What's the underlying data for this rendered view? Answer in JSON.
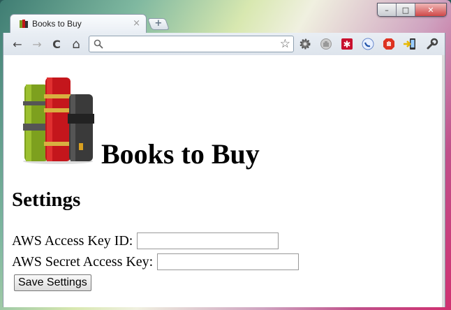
{
  "window": {
    "controls": {
      "minimize": "–",
      "maximize": "□",
      "close": "✕"
    }
  },
  "tab": {
    "title": "Books to Buy",
    "close": "×",
    "newtab": "+"
  },
  "toolbar": {
    "back": "←",
    "forward": "→",
    "reload": "C",
    "home": "⌂",
    "address_value": "",
    "star": "☆"
  },
  "page": {
    "site_title": "Books to Buy",
    "settings_heading": "Settings",
    "access_key_label": "AWS Access Key ID:",
    "access_key_value": "",
    "secret_key_label": "AWS Secret Access Key:",
    "secret_key_value": "",
    "save_button": "Save Settings"
  },
  "icons": {
    "extensions": [
      "gear-icon",
      "shield-icon",
      "lastpass-icon",
      "phone-icon",
      "adblock-icon",
      "exit-icon",
      "wrench-icon"
    ]
  }
}
